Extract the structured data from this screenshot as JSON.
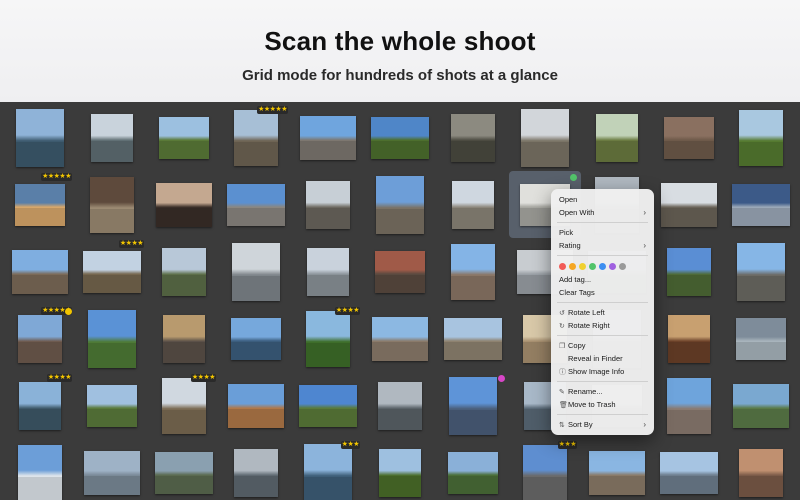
{
  "hero": {
    "title": "Scan the whole shoot",
    "subtitle": "Grid mode for hundreds of shots at a glance"
  },
  "grid": {
    "rows": [
      [
        {
          "name": "photo-lake-pier",
          "c1": "#8fb3d8",
          "c2": "#3d5a6e",
          "stars": "",
          "dot": ""
        },
        {
          "name": "photo-cloudy-lake",
          "c1": "#c9d3dc",
          "c2": "#5f6e73",
          "stars": "",
          "dot": ""
        },
        {
          "name": "photo-green-field",
          "c1": "#9cc0e0",
          "c2": "#5a7a38",
          "stars": "",
          "dot": ""
        },
        {
          "name": "photo-ruins",
          "c1": "#a7bfd6",
          "c2": "#6e6454",
          "stars": "★★★★★",
          "dot": ""
        },
        {
          "name": "photo-street-houses",
          "c1": "#6fa5de",
          "c2": "#7d7770",
          "stars": "",
          "dot": ""
        },
        {
          "name": "photo-garden-house",
          "c1": "#4f86c8",
          "c2": "#4d6f2e",
          "stars": "",
          "dot": ""
        },
        {
          "name": "photo-model-railway",
          "c1": "#8c8a80",
          "c2": "#4b4a40",
          "stars": "",
          "dot": ""
        },
        {
          "name": "photo-statue-park",
          "c1": "#d2d6da",
          "c2": "#7a7466",
          "stars": "",
          "dot": ""
        },
        {
          "name": "photo-tree-path",
          "c1": "#c1d2b8",
          "c2": "#6a7a40",
          "stars": "",
          "dot": ""
        },
        {
          "name": "photo-bottles-table",
          "c1": "#8a7060",
          "c2": "#6e5a4a",
          "stars": "",
          "dot": ""
        },
        {
          "name": "photo-green-yard",
          "c1": "#a9c8e0",
          "c2": "#557a30",
          "stars": "",
          "dot": ""
        }
      ],
      [
        {
          "name": "photo-sunset-sea",
          "c1": "#5a7fa8",
          "c2": "#d8a76a",
          "stars": "★★★★★",
          "dot": ""
        },
        {
          "name": "photo-ceiling-interior",
          "c1": "#5e4a3c",
          "c2": "#9b8a72",
          "stars": "",
          "dot": ""
        },
        {
          "name": "photo-dark-trees",
          "c1": "#c4a890",
          "c2": "#3a2e28",
          "stars": "",
          "dot": ""
        },
        {
          "name": "photo-white-house",
          "c1": "#5b90d0",
          "c2": "#8a8680",
          "stars": "",
          "dot": ""
        },
        {
          "name": "photo-bare-trees-square",
          "c1": "#c7cfd6",
          "c2": "#6a665e",
          "stars": "",
          "dot": ""
        },
        {
          "name": "photo-town-hall",
          "c1": "#6d9ed8",
          "c2": "#7a7164",
          "stars": "",
          "dot": ""
        },
        {
          "name": "photo-old-building",
          "c1": "#cfd7e0",
          "c2": "#8a8478",
          "stars": "",
          "dot": ""
        },
        {
          "name": "photo-selected-interior",
          "c1": "#e0e0dc",
          "c2": "#a8a8a2",
          "stars": "",
          "dot": "#52c46a"
        },
        {
          "name": "photo-hidden-1",
          "c1": "#b0b8c0",
          "c2": "#7a7a7a",
          "stars": "",
          "dot": ""
        },
        {
          "name": "photo-white-cottages",
          "c1": "#d8dde2",
          "c2": "#6a6358",
          "stars": "",
          "dot": ""
        },
        {
          "name": "photo-evening-sea",
          "c1": "#3c5a88",
          "c2": "#9ba8b8",
          "stars": "",
          "dot": ""
        }
      ],
      [
        {
          "name": "photo-village-street",
          "c1": "#7faee0",
          "c2": "#7b6a58",
          "stars": "",
          "dot": ""
        },
        {
          "name": "photo-church-ruin",
          "c1": "#c2d2e2",
          "c2": "#75664e",
          "stars": "★★★★",
          "dot": ""
        },
        {
          "name": "photo-manor",
          "c1": "#b8c8d8",
          "c2": "#5c6e48",
          "stars": "",
          "dot": ""
        },
        {
          "name": "photo-grey-harbor",
          "c1": "#cfd5da",
          "c2": "#7e858a",
          "stars": "",
          "dot": ""
        },
        {
          "name": "photo-pier-lake",
          "c1": "#c9d2dc",
          "c2": "#8a9298",
          "stars": "",
          "dot": ""
        },
        {
          "name": "photo-red-facade",
          "c1": "#a05a48",
          "c2": "#5a4a40",
          "stars": "",
          "dot": ""
        },
        {
          "name": "photo-shop-street",
          "c1": "#84b4e6",
          "c2": "#8a7666",
          "stars": "",
          "dot": ""
        },
        {
          "name": "photo-misty-water",
          "c1": "#c8ccd0",
          "c2": "#9aa0a6",
          "stars": "",
          "dot": ""
        },
        {
          "name": "photo-hidden-2",
          "c1": "#98a8b0",
          "c2": "#5a6a5a",
          "stars": "",
          "dot": ""
        },
        {
          "name": "photo-blue-sky-yard",
          "c1": "#5a8ed4",
          "c2": "#4e6a36",
          "stars": "",
          "dot": ""
        },
        {
          "name": "photo-apartment-block",
          "c1": "#86b6e6",
          "c2": "#6c6a64",
          "stars": "",
          "dot": ""
        }
      ],
      [
        {
          "name": "photo-rocky-coast",
          "c1": "#7fa8d6",
          "c2": "#6e5a4e",
          "stars": "★★★★★",
          "dot": "#f2c500"
        },
        {
          "name": "photo-meadow-clouds",
          "c1": "#5a92d6",
          "c2": "#4e7a36",
          "stars": "",
          "dot": ""
        },
        {
          "name": "photo-golden-hall",
          "c1": "#b89a6e",
          "c2": "#5a5048",
          "stars": "",
          "dot": ""
        },
        {
          "name": "photo-lake-clouds",
          "c1": "#76a8dc",
          "c2": "#3c5e7e",
          "stars": "",
          "dot": ""
        },
        {
          "name": "photo-park-bushes",
          "c1": "#8ab8de",
          "c2": "#3e6e2a",
          "stars": "★★★★",
          "dot": ""
        },
        {
          "name": "photo-town-alley",
          "c1": "#8cb8e2",
          "c2": "#8a7a6a",
          "stars": "",
          "dot": ""
        },
        {
          "name": "photo-cobbled-street",
          "c1": "#a8c4e0",
          "c2": "#8e8270",
          "stars": "",
          "dot": ""
        },
        {
          "name": "photo-sand-dune",
          "c1": "#d8c8a8",
          "c2": "#a89070",
          "stars": "",
          "dot": ""
        },
        {
          "name": "photo-hidden-3",
          "c1": "#a0a8b0",
          "c2": "#6a6a6a",
          "stars": "",
          "dot": ""
        },
        {
          "name": "photo-wooden-cabinet",
          "c1": "#c8a070",
          "c2": "#6a4028",
          "stars": "",
          "dot": ""
        },
        {
          "name": "photo-calm-lake",
          "c1": "#7e8c9a",
          "c2": "#a8b4bc",
          "stars": "",
          "dot": ""
        }
      ],
      [
        {
          "name": "photo-rowboat",
          "c1": "#8ab2d8",
          "c2": "#3e5868",
          "stars": "★★★★",
          "dot": ""
        },
        {
          "name": "photo-hill-clouds",
          "c1": "#a0c0e0",
          "c2": "#5a7a3c",
          "stars": "",
          "dot": ""
        },
        {
          "name": "photo-stone-ruins",
          "c1": "#d0d8e0",
          "c2": "#7a6a52",
          "stars": "★★★★",
          "dot": ""
        },
        {
          "name": "photo-church-tower",
          "c1": "#6a9ed8",
          "c2": "#b07848",
          "stars": "",
          "dot": ""
        },
        {
          "name": "photo-manor-garden",
          "c1": "#4e86d0",
          "c2": "#5a7a3a",
          "stars": "",
          "dot": ""
        },
        {
          "name": "photo-harbor-grey",
          "c1": "#b0b8c0",
          "c2": "#5a6268",
          "stars": "",
          "dot": ""
        },
        {
          "name": "photo-winter-tree",
          "c1": "#5e94d8",
          "c2": "#4a5e7a",
          "stars": "",
          "dot": "#d846c8"
        },
        {
          "name": "photo-hidden-4",
          "c1": "#a8b8c8",
          "c2": "#5a6a78",
          "stars": "",
          "dot": ""
        },
        {
          "name": "photo-hidden-5",
          "c1": "#b0b8c0",
          "c2": "#6a6a6a",
          "stars": "",
          "dot": ""
        },
        {
          "name": "photo-church-spire",
          "c1": "#6ea4dc",
          "c2": "#8a7a70",
          "stars": "",
          "dot": ""
        },
        {
          "name": "photo-aerial-lake",
          "c1": "#7aa8d0",
          "c2": "#5a7a48",
          "stars": "",
          "dot": ""
        }
      ],
      [
        {
          "name": "photo-frosty-tree",
          "c1": "#6c9ed8",
          "c2": "#dde4ea",
          "stars": "",
          "dot": ""
        },
        {
          "name": "photo-dusk-water",
          "c1": "#9eb2c6",
          "c2": "#7a8a98",
          "stars": "",
          "dot": ""
        },
        {
          "name": "photo-aerial-park",
          "c1": "#8aa0b0",
          "c2": "#5a6a50",
          "stars": "",
          "dot": ""
        },
        {
          "name": "photo-harbor-sunset",
          "c1": "#b0b8c0",
          "c2": "#5e6870",
          "stars": "",
          "dot": ""
        },
        {
          "name": "photo-island-lake",
          "c1": "#8cb4dc",
          "c2": "#3e5e78",
          "stars": "★★★",
          "dot": ""
        },
        {
          "name": "photo-green-hill",
          "c1": "#9ec0e0",
          "c2": "#4a6e2a",
          "stars": "",
          "dot": ""
        },
        {
          "name": "photo-waterfall-garden",
          "c1": "#8ab0d8",
          "c2": "#4a6e38",
          "stars": "",
          "dot": ""
        },
        {
          "name": "photo-harbor-boats",
          "c1": "#5e8ed0",
          "c2": "#6a6a6a",
          "stars": "★★★",
          "dot": ""
        },
        {
          "name": "photo-town-square",
          "c1": "#8ab6e2",
          "c2": "#8a7a68",
          "stars": "",
          "dot": ""
        },
        {
          "name": "photo-beach-clouds",
          "c1": "#a6c4e2",
          "c2": "#6e7e8e",
          "stars": "",
          "dot": ""
        },
        {
          "name": "photo-autumn-coast",
          "c1": "#c09070",
          "c2": "#7a5a48",
          "stars": "",
          "dot": ""
        }
      ]
    ]
  },
  "context_menu": {
    "open": "Open",
    "open_with": "Open With",
    "pick": "Pick",
    "rating": "Rating",
    "colors": [
      "#f25b57",
      "#f5a623",
      "#f0d030",
      "#52c46a",
      "#3d8ef0",
      "#a060e0",
      "#9a9a9a"
    ],
    "add_tag": "Add tag...",
    "clear_tags": "Clear Tags",
    "rotate_left": "Rotate Left",
    "rotate_right": "Rotate Right",
    "copy": "Copy",
    "reveal_in_finder": "Reveal in Finder",
    "show_image_info": "Show Image Info",
    "rename": "Rename...",
    "move_to_trash": "Move to Trash",
    "sort_by": "Sort By",
    "submenu_arrow": "›"
  }
}
